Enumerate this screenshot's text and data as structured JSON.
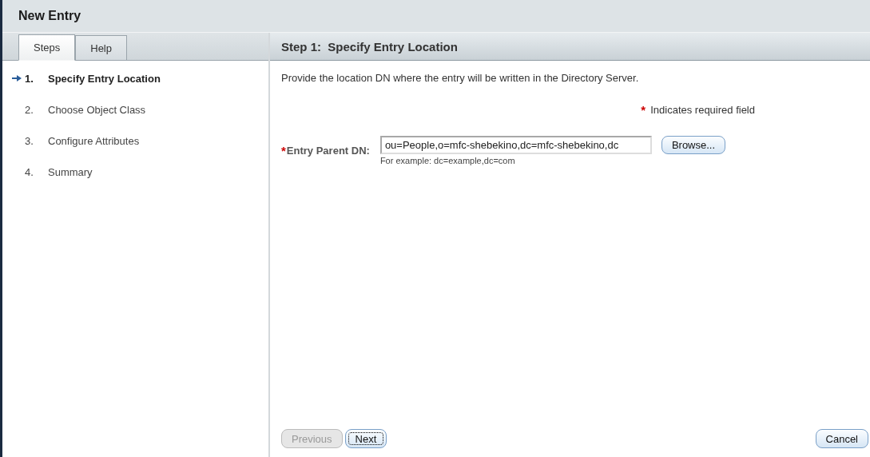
{
  "window": {
    "title": "New Entry"
  },
  "tabs": [
    {
      "label": "Steps",
      "selected": true
    },
    {
      "label": "Help",
      "selected": false
    }
  ],
  "steps": [
    {
      "number": "1.",
      "label": "Specify Entry Location",
      "selected": true
    },
    {
      "number": "2.",
      "label": "Choose Object Class",
      "selected": false
    },
    {
      "number": "3.",
      "label": "Configure Attributes",
      "selected": false
    },
    {
      "number": "4.",
      "label": "Summary",
      "selected": false
    }
  ],
  "content": {
    "heading": "Step 1:  Specify Entry Location",
    "description": "Provide the location DN where the entry will be written in the Directory Server.",
    "required_mark": "*",
    "required_note": "Indicates required field",
    "field": {
      "required_mark": "*",
      "label": "Entry Parent DN:",
      "value": "ou=People,o=mfc-shebekino,dc=mfc-shebekino,dc",
      "hint": "For example: dc=example,dc=com",
      "button": "Browse..."
    }
  },
  "buttons": [
    {
      "label": "Previous",
      "disabled": true,
      "focused": false
    },
    {
      "label": "Next",
      "disabled": false,
      "focused": true
    },
    {
      "label": "Cancel",
      "disabled": false,
      "focused": false
    }
  ]
}
